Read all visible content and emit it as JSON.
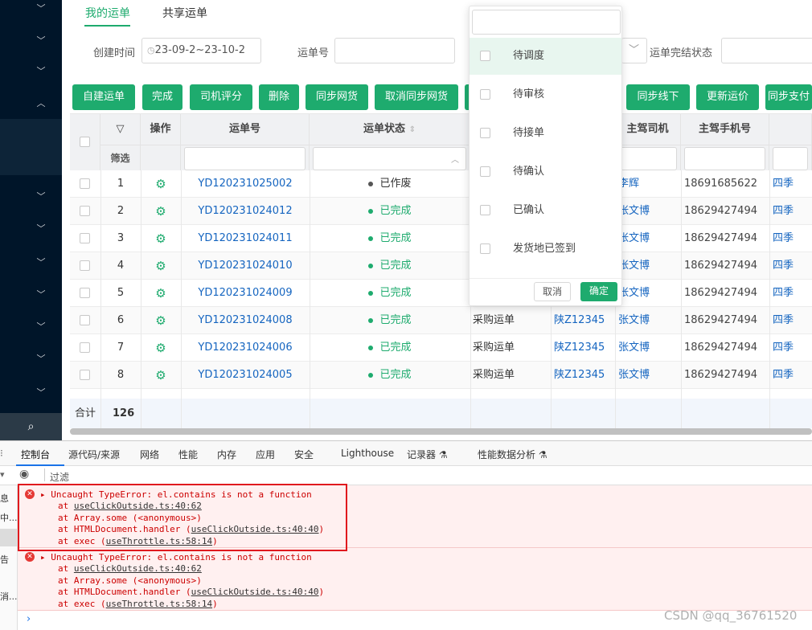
{
  "tabs": [
    {
      "label": "我的运单"
    },
    {
      "label": "共享运单"
    }
  ],
  "filters": {
    "create_time_label": "创建时间",
    "create_time_value": "23-09-2~23-10-2",
    "waybill_no_label": "运单号",
    "finish_status_label": "运单完结状态"
  },
  "toolbar": [
    "自建运单",
    "完成",
    "司机评分",
    "删除",
    "同步网货",
    "取消同步网货",
    "同步线下",
    "更新运价",
    "同步支付"
  ],
  "table": {
    "headers": {
      "op": "操作",
      "waybill": "运单号",
      "status": "运单状态",
      "driver": "主驾司机",
      "phone": "主驾手机号",
      "filter": "筛选"
    },
    "rows": [
      {
        "idx": "1",
        "no": "YD120231025002",
        "status": "已作废",
        "status_color": "#555555",
        "type": "",
        "plate": "",
        "driver": "李辉",
        "phone": "18691685622",
        "extra": "四季"
      },
      {
        "idx": "2",
        "no": "YD120231024012",
        "status": "已完成",
        "status_color": "#1eab6e",
        "type": "",
        "plate": "",
        "driver": "张文博",
        "phone": "18629427494",
        "extra": "四季"
      },
      {
        "idx": "3",
        "no": "YD120231024011",
        "status": "已完成",
        "status_color": "#1eab6e",
        "type": "",
        "plate": "",
        "driver": "张文博",
        "phone": "18629427494",
        "extra": "四季"
      },
      {
        "idx": "4",
        "no": "YD120231024010",
        "status": "已完成",
        "status_color": "#1eab6e",
        "type": "",
        "plate": "",
        "driver": "张文博",
        "phone": "18629427494",
        "extra": "四季"
      },
      {
        "idx": "5",
        "no": "YD120231024009",
        "status": "已完成",
        "status_color": "#1eab6e",
        "type": "",
        "plate": "",
        "driver": "张文博",
        "phone": "18629427494",
        "extra": "四季"
      },
      {
        "idx": "6",
        "no": "YD120231024008",
        "status": "已完成",
        "status_color": "#1eab6e",
        "type": "采购运单",
        "plate": "陕Z12345",
        "driver": "张文博",
        "phone": "18629427494",
        "extra": "四季"
      },
      {
        "idx": "7",
        "no": "YD120231024006",
        "status": "已完成",
        "status_color": "#1eab6e",
        "type": "采购运单",
        "plate": "陕Z12345",
        "driver": "张文博",
        "phone": "18629427494",
        "extra": "四季"
      },
      {
        "idx": "8",
        "no": "YD120231024005",
        "status": "已完成",
        "status_color": "#1eab6e",
        "type": "采购运单",
        "plate": "陕Z12345",
        "driver": "张文博",
        "phone": "18629427494",
        "extra": "四季"
      }
    ],
    "sum_label": "合计",
    "sum_value": "126"
  },
  "dropdown": {
    "options": [
      "待调度",
      "待审核",
      "待接单",
      "待确认",
      "已确认",
      "发货地已签到"
    ],
    "cancel": "取消",
    "confirm": "确定"
  },
  "devtools": {
    "tabs": [
      "控制台",
      "源代码/来源",
      "网络",
      "性能",
      "内存",
      "应用",
      "安全",
      "Lighthouse",
      "记录器",
      "性能数据分析"
    ],
    "filter_placeholder": "过滤",
    "errors": [
      {
        "title": "Uncaught TypeError: el.contains is not a function",
        "frames": [
          {
            "prefix": "at ",
            "fn": "",
            "file": "useClickOutside.ts:40:62"
          },
          {
            "prefix": "at ",
            "fn": "Array.some (<anonymous>)",
            "file": ""
          },
          {
            "prefix": "at ",
            "fn": "HTMLDocument.handler (",
            "file": "useClickOutside.ts:40:40",
            "suffix": ")"
          },
          {
            "prefix": "at ",
            "fn": "exec (",
            "file": "useThrottle.ts:58:14",
            "suffix": ")"
          }
        ]
      },
      {
        "title": "Uncaught TypeError: el.contains is not a function",
        "frames": [
          {
            "prefix": "at ",
            "fn": "",
            "file": "useClickOutside.ts:40:62"
          },
          {
            "prefix": "at ",
            "fn": "Array.some (<anonymous>)",
            "file": ""
          },
          {
            "prefix": "at ",
            "fn": "HTMLDocument.handler (",
            "file": "useClickOutside.ts:40:40",
            "suffix": ")"
          },
          {
            "prefix": "at ",
            "fn": "exec (",
            "file": "useThrottle.ts:58:14",
            "suffix": ")"
          }
        ]
      }
    ],
    "left_labels": [
      "息",
      "中...",
      "告",
      "消..."
    ]
  },
  "watermark": "CSDN @qq_36761520"
}
